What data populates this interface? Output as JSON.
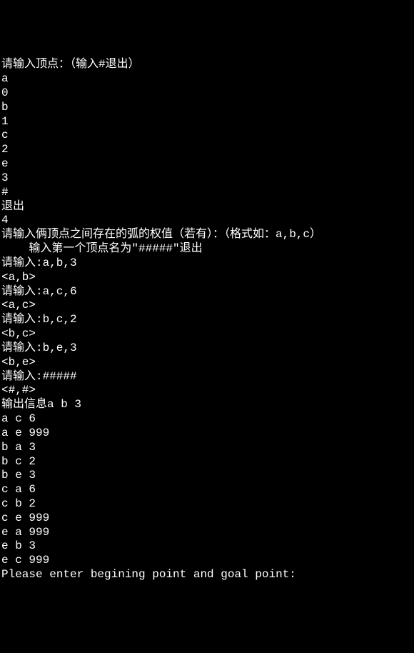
{
  "lines": [
    "请输入顶点：（输入#退出）",
    "a",
    "0",
    "b",
    "1",
    "c",
    "2",
    "e",
    "3",
    "#",
    "退出",
    "4",
    "请输入俩顶点之间存在的弧的权值（若有）：（格式如：a,b,c）",
    "    输入第一个顶点名为\"#####\"退出",
    "请输入:a,b,3",
    "<a,b>",
    "请输入:a,c,6",
    "<a,c>",
    "请输入:b,c,2",
    "<b,c>",
    "请输入:b,e,3",
    "<b,e>",
    "请输入:#####",
    "<#,#>",
    "输出信息a b 3",
    "a c 6",
    "a e 999",
    "b a 3",
    "b c 2",
    "b e 3",
    "c a 6",
    "c b 2",
    "c e 999",
    "e a 999",
    "e b 3",
    "e c 999",
    "Please enter begining point and goal point:"
  ]
}
